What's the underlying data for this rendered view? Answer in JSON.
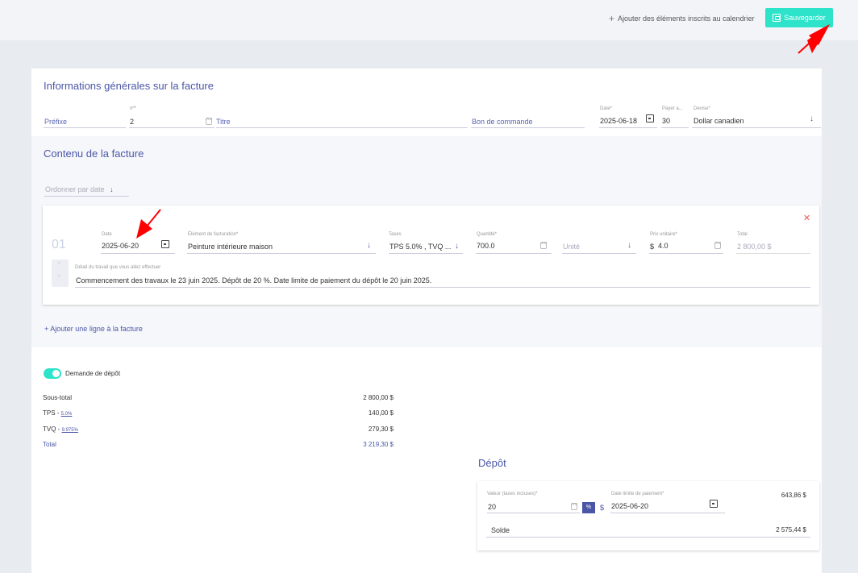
{
  "topbar": {
    "add_calendar": "Ajouter des éléments inscrits au calendrier",
    "save": "Sauvegarder"
  },
  "general": {
    "title": "Informations générales sur la facture",
    "prefix_placeholder": "Préfixe",
    "number_label": "nº*",
    "number_value": "2",
    "title_placeholder": "Titre",
    "po_placeholder": "Bon de commande",
    "date_label": "Date*",
    "date_value": "2025-06-18",
    "pay_label": "Payer a...",
    "pay_value": "30",
    "currency_label": "Devise*",
    "currency_value": "Dollar canadien"
  },
  "content": {
    "title": "Contenu de la facture",
    "order_by": "Ordonner par date",
    "line": {
      "number": "01",
      "date_label": "Date",
      "date_value": "2025-06-20",
      "item_label": "Élément de facturation*",
      "item_value": "Peinture intérieure maison",
      "taxes_label": "Taxes",
      "taxes_value": "TPS 5.0% , TVQ ...",
      "qty_label": "Quantité*",
      "qty_value": "700.0",
      "unit_placeholder": "Unité",
      "price_label": "Prix unitaire*",
      "price_currency": "$",
      "price_value": "4.0",
      "total_label": "Total",
      "total_value": "2 800,00 $",
      "detail_label": "Détail du travail que vous allez effectuer",
      "detail_value": "Commencement des travaux le 23 juin 2025. Dépôt de 20 %. Date limite de paiement du dépôt le 20 juin 2025."
    },
    "add_line": "Ajouter une ligne à la facture"
  },
  "summary": {
    "deposit_toggle": "Demande de dépôt",
    "subtotal_label": "Sous-total",
    "subtotal_value": "2 800,00 $",
    "tps_label": "TPS - ",
    "tps_rate": "5.0%",
    "tps_value": "140,00 $",
    "tvq_label": "TVQ - ",
    "tvq_rate": "9.975%",
    "tvq_value": "279,30 $",
    "total_label": "Total",
    "total_value": "3 219,30 $"
  },
  "deposit": {
    "title": "Dépôt",
    "value_label": "Valeur (taxes incluses)*",
    "value": "20",
    "pct": "%",
    "dollar": "$",
    "due_label": "Date limite de paiement*",
    "due_value": "2025-06-20",
    "amount": "643,86 $",
    "balance_label": "Solde",
    "balance_value": "2 575,44 $"
  },
  "colors": {
    "accent": "#2de3c9",
    "primary": "#4a56a6",
    "annotation": "#ff0000"
  }
}
